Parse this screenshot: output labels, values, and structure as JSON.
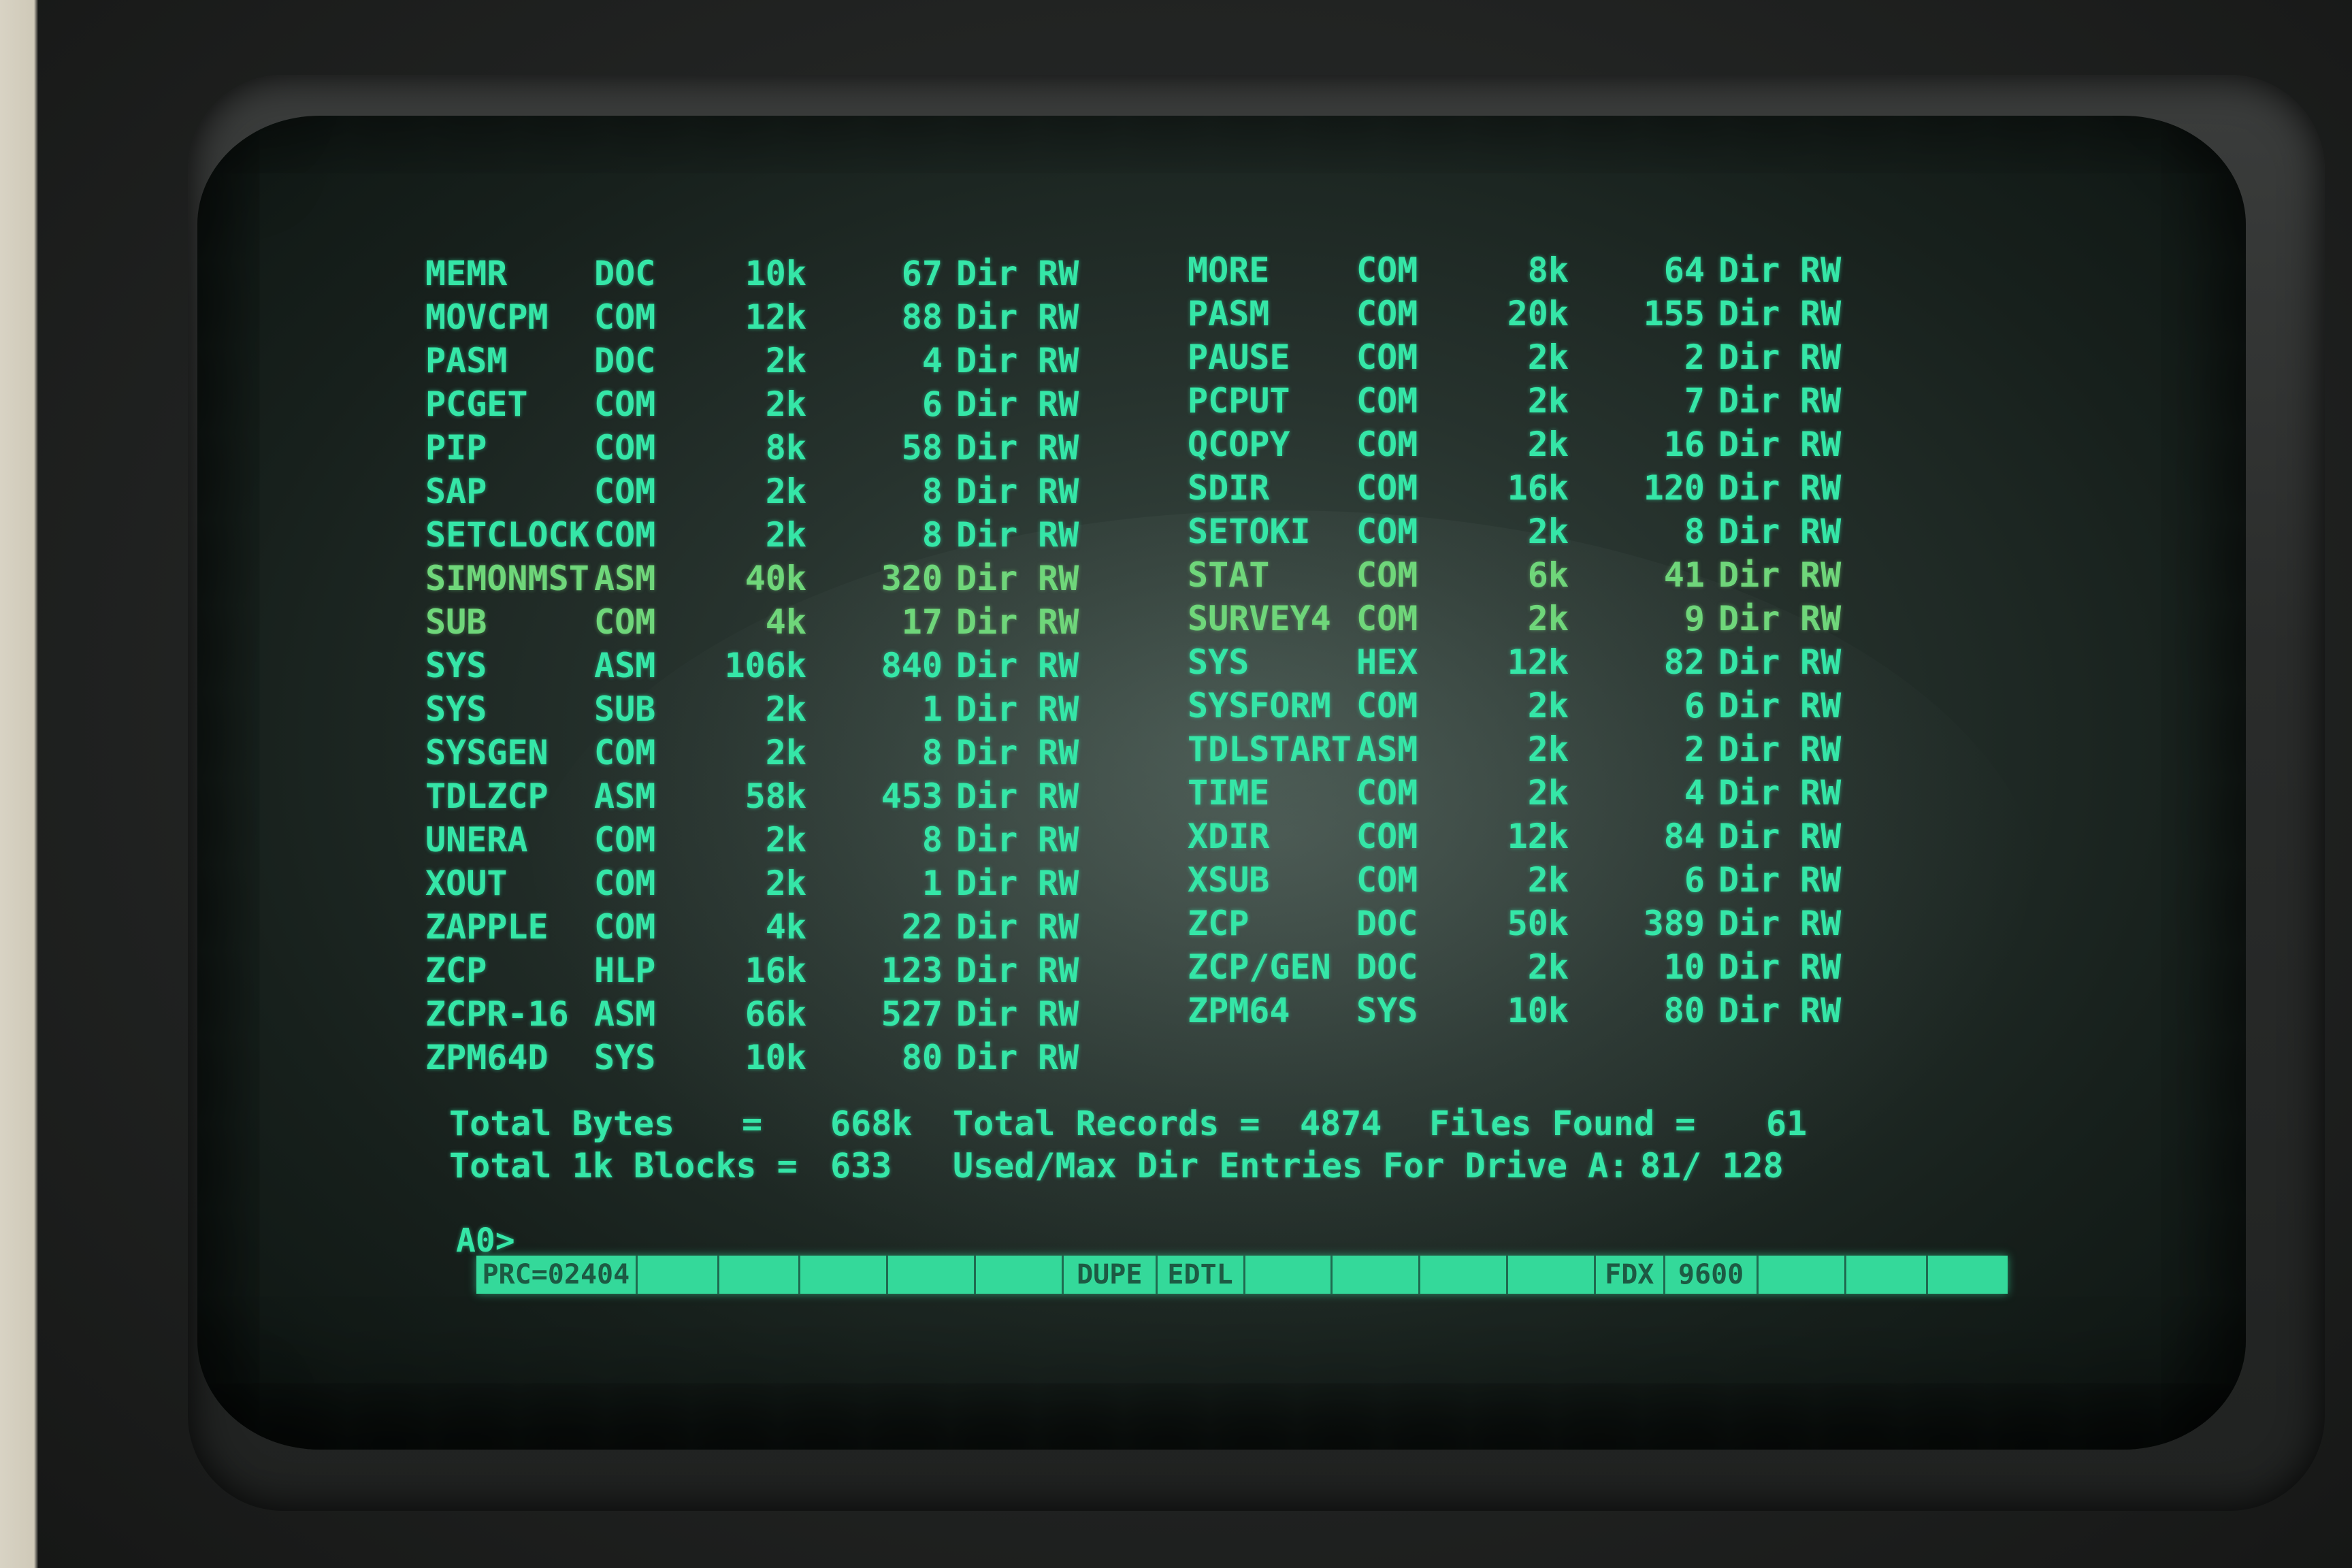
{
  "listing": {
    "left": [
      {
        "name": "MEMR",
        "ext": "DOC",
        "size": "10k",
        "records": "67",
        "dir": "Dir",
        "attr": "RW"
      },
      {
        "name": "MOVCPM",
        "ext": "COM",
        "size": "12k",
        "records": "88",
        "dir": "Dir",
        "attr": "RW"
      },
      {
        "name": "PASM",
        "ext": "DOC",
        "size": "2k",
        "records": "4",
        "dir": "Dir",
        "attr": "RW"
      },
      {
        "name": "PCGET",
        "ext": "COM",
        "size": "2k",
        "records": "6",
        "dir": "Dir",
        "attr": "RW"
      },
      {
        "name": "PIP",
        "ext": "COM",
        "size": "8k",
        "records": "58",
        "dir": "Dir",
        "attr": "RW"
      },
      {
        "name": "SAP",
        "ext": "COM",
        "size": "2k",
        "records": "8",
        "dir": "Dir",
        "attr": "RW"
      },
      {
        "name": "SETCLOCK",
        "ext": "COM",
        "size": "2k",
        "records": "8",
        "dir": "Dir",
        "attr": "RW"
      },
      {
        "name": "SIMONMST",
        "ext": "ASM",
        "size": "40k",
        "records": "320",
        "dir": "Dir",
        "attr": "RW"
      },
      {
        "name": "SUB",
        "ext": "COM",
        "size": "4k",
        "records": "17",
        "dir": "Dir",
        "attr": "RW"
      },
      {
        "name": "SYS",
        "ext": "ASM",
        "size": "106k",
        "records": "840",
        "dir": "Dir",
        "attr": "RW"
      },
      {
        "name": "SYS",
        "ext": "SUB",
        "size": "2k",
        "records": "1",
        "dir": "Dir",
        "attr": "RW"
      },
      {
        "name": "SYSGEN",
        "ext": "COM",
        "size": "2k",
        "records": "8",
        "dir": "Dir",
        "attr": "RW"
      },
      {
        "name": "TDLZCP",
        "ext": "ASM",
        "size": "58k",
        "records": "453",
        "dir": "Dir",
        "attr": "RW"
      },
      {
        "name": "UNERA",
        "ext": "COM",
        "size": "2k",
        "records": "8",
        "dir": "Dir",
        "attr": "RW"
      },
      {
        "name": "XOUT",
        "ext": "COM",
        "size": "2k",
        "records": "1",
        "dir": "Dir",
        "attr": "RW"
      },
      {
        "name": "ZAPPLE",
        "ext": "COM",
        "size": "4k",
        "records": "22",
        "dir": "Dir",
        "attr": "RW"
      },
      {
        "name": "ZCP",
        "ext": "HLP",
        "size": "16k",
        "records": "123",
        "dir": "Dir",
        "attr": "RW"
      },
      {
        "name": "ZCPR-16",
        "ext": "ASM",
        "size": "66k",
        "records": "527",
        "dir": "Dir",
        "attr": "RW"
      },
      {
        "name": "ZPM64D",
        "ext": "SYS",
        "size": "10k",
        "records": "80",
        "dir": "Dir",
        "attr": "RW"
      }
    ],
    "right": [
      {
        "name": "MORE",
        "ext": "COM",
        "size": "8k",
        "records": "64",
        "dir": "Dir",
        "attr": "RW"
      },
      {
        "name": "PASM",
        "ext": "COM",
        "size": "20k",
        "records": "155",
        "dir": "Dir",
        "attr": "RW"
      },
      {
        "name": "PAUSE",
        "ext": "COM",
        "size": "2k",
        "records": "2",
        "dir": "Dir",
        "attr": "RW"
      },
      {
        "name": "PCPUT",
        "ext": "COM",
        "size": "2k",
        "records": "7",
        "dir": "Dir",
        "attr": "RW"
      },
      {
        "name": "QCOPY",
        "ext": "COM",
        "size": "2k",
        "records": "16",
        "dir": "Dir",
        "attr": "RW"
      },
      {
        "name": "SDIR",
        "ext": "COM",
        "size": "16k",
        "records": "120",
        "dir": "Dir",
        "attr": "RW"
      },
      {
        "name": "SETOKI",
        "ext": "COM",
        "size": "2k",
        "records": "8",
        "dir": "Dir",
        "attr": "RW"
      },
      {
        "name": "STAT",
        "ext": "COM",
        "size": "6k",
        "records": "41",
        "dir": "Dir",
        "attr": "RW"
      },
      {
        "name": "SURVEY4",
        "ext": "COM",
        "size": "2k",
        "records": "9",
        "dir": "Dir",
        "attr": "RW"
      },
      {
        "name": "SYS",
        "ext": "HEX",
        "size": "12k",
        "records": "82",
        "dir": "Dir",
        "attr": "RW"
      },
      {
        "name": "SYSFORM",
        "ext": "COM",
        "size": "2k",
        "records": "6",
        "dir": "Dir",
        "attr": "RW"
      },
      {
        "name": "TDLSTART",
        "ext": "ASM",
        "size": "2k",
        "records": "2",
        "dir": "Dir",
        "attr": "RW"
      },
      {
        "name": "TIME",
        "ext": "COM",
        "size": "2k",
        "records": "4",
        "dir": "Dir",
        "attr": "RW"
      },
      {
        "name": "XDIR",
        "ext": "COM",
        "size": "12k",
        "records": "84",
        "dir": "Dir",
        "attr": "RW"
      },
      {
        "name": "XSUB",
        "ext": "COM",
        "size": "2k",
        "records": "6",
        "dir": "Dir",
        "attr": "RW"
      },
      {
        "name": "ZCP",
        "ext": "DOC",
        "size": "50k",
        "records": "389",
        "dir": "Dir",
        "attr": "RW"
      },
      {
        "name": "ZCP/GEN",
        "ext": "DOC",
        "size": "2k",
        "records": "10",
        "dir": "Dir",
        "attr": "RW"
      },
      {
        "name": "ZPM64",
        "ext": "SYS",
        "size": "10k",
        "records": "80",
        "dir": "Dir",
        "attr": "RW"
      }
    ]
  },
  "totals": {
    "bytes_label": "Total Bytes",
    "bytes_eq": "=",
    "bytes_value": "668k",
    "records_label": "Total Records =",
    "records_value": "4874",
    "files_label": "Files Found =",
    "files_value": "61",
    "blocks_label": "Total 1k Blocks =",
    "blocks_value": "633",
    "entries_label": "Used/Max Dir Entries For Drive A:",
    "entries_value": "81/ 128"
  },
  "prompt": "A0>",
  "status_bar": [
    "PRC=02404",
    "",
    "",
    "",
    "",
    "",
    "DUPE",
    "EDTL",
    "",
    "",
    "",
    "",
    "FDX",
    "9600",
    "",
    "",
    ""
  ],
  "colors": {
    "phosphor": "#35e6a7",
    "highlight_rows": "#6fd67a",
    "status_bar": "#34d99a",
    "status_text": "#1d5a43"
  }
}
